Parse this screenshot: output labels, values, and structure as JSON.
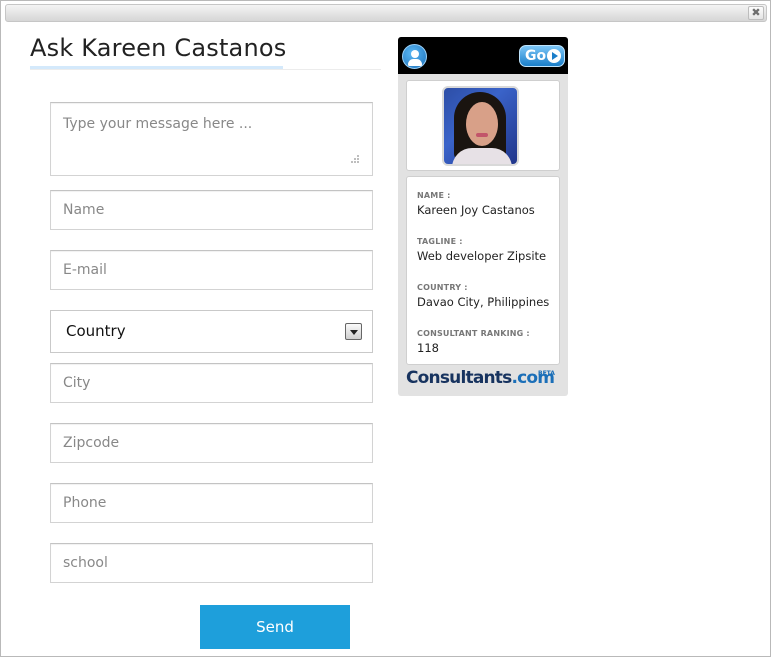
{
  "dialog": {
    "close_glyph": "✖",
    "title": "Ask Kareen Castanos"
  },
  "form": {
    "message_placeholder": "Type your message here ...",
    "name_placeholder": "Name",
    "email_placeholder": "E-mail",
    "country_selected": "Country",
    "city_placeholder": "City",
    "zipcode_placeholder": "Zipcode",
    "phone_placeholder": "Phone",
    "school_placeholder": "school",
    "send_label": "Send"
  },
  "widget": {
    "go_label": "Go",
    "profile": {
      "name_label": "NAME :",
      "name_value": "Kareen Joy Castanos",
      "tagline_label": "TAGLINE :",
      "tagline_value": "Web developer Zipsite",
      "country_label": "COUNTRY :",
      "country_value": "Davao City, Philippines",
      "ranking_label": "CONSULTANT RANKING :",
      "ranking_value": "118"
    },
    "brand_main": "Consultants",
    "brand_suffix": ".com",
    "brand_badge": "BETA"
  },
  "colors": {
    "accent": "#1e9fdb",
    "title_underline": "#d4e9fb",
    "widget_header": "#000000",
    "brand": "#17335f"
  },
  "icons": [
    "close-icon",
    "user-icon",
    "go-arrow-icon",
    "resize-grip-icon",
    "dropdown-arrow-icon"
  ]
}
